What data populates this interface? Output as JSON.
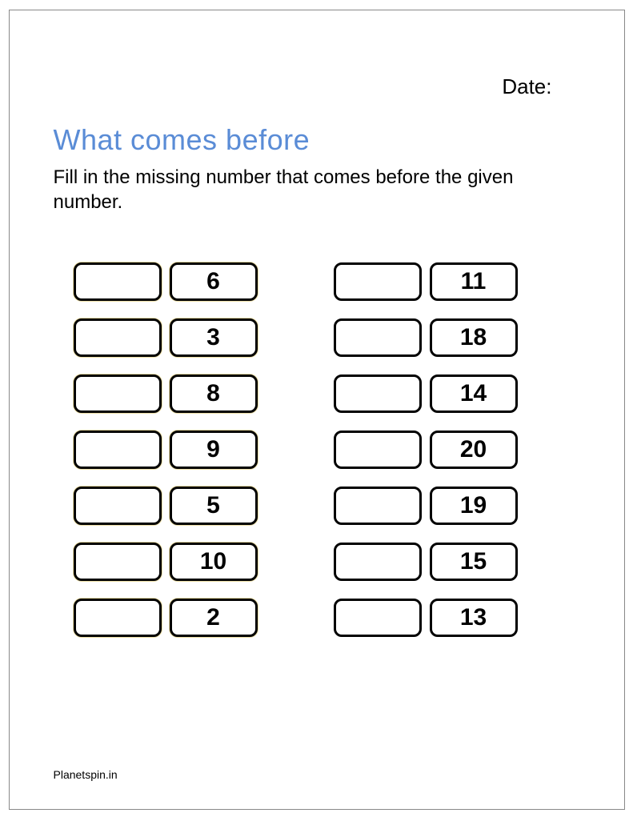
{
  "header": {
    "date_label": "Date:"
  },
  "title": "What comes before",
  "instructions": "Fill in the missing number that comes before the given number.",
  "columns": {
    "left": [
      {
        "blank": "",
        "given": "6"
      },
      {
        "blank": "",
        "given": "3"
      },
      {
        "blank": "",
        "given": "8"
      },
      {
        "blank": "",
        "given": "9"
      },
      {
        "blank": "",
        "given": "5"
      },
      {
        "blank": "",
        "given": "10"
      },
      {
        "blank": "",
        "given": "2"
      }
    ],
    "right": [
      {
        "blank": "",
        "given": "11"
      },
      {
        "blank": "",
        "given": "18"
      },
      {
        "blank": "",
        "given": "14"
      },
      {
        "blank": "",
        "given": "20"
      },
      {
        "blank": "",
        "given": "19"
      },
      {
        "blank": "",
        "given": "15"
      },
      {
        "blank": "",
        "given": "13"
      }
    ]
  },
  "footer": "Planetspin.in"
}
